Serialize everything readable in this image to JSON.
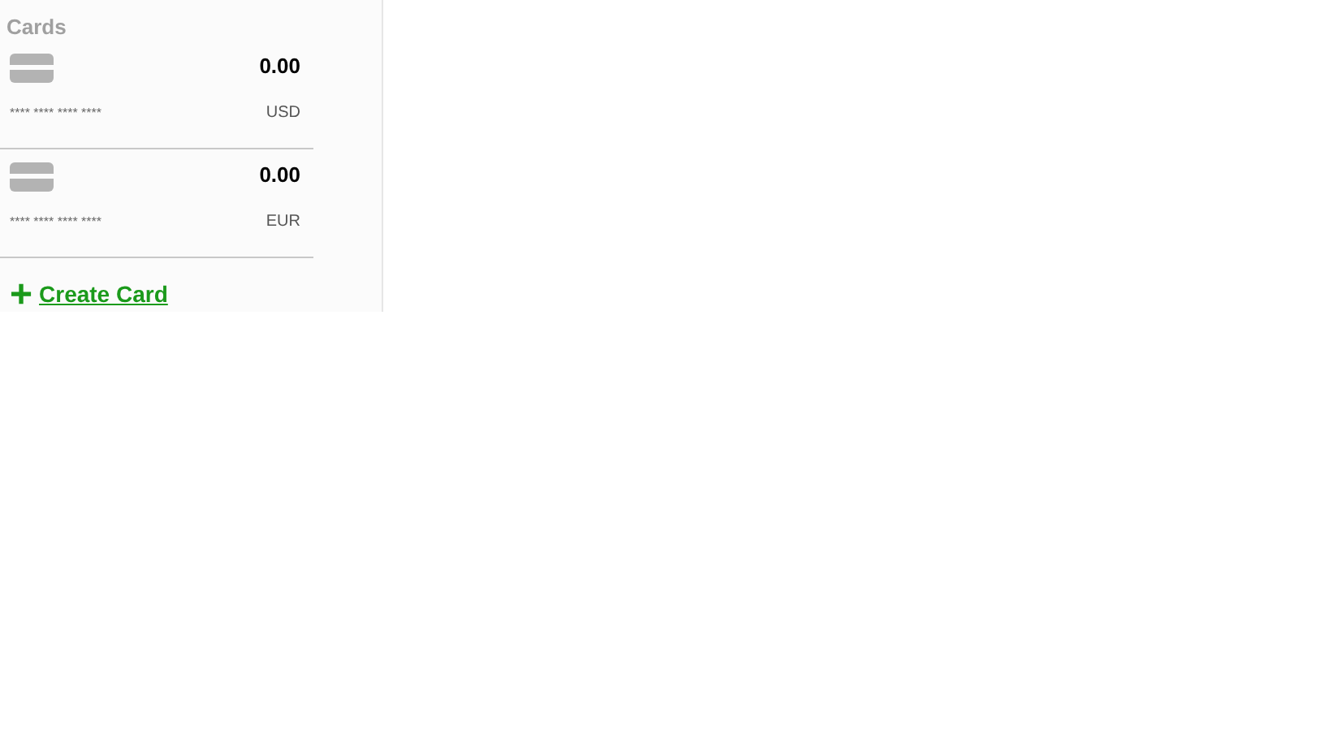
{
  "section_title": "Cards",
  "cards": [
    {
      "balance": "0.00",
      "number": "**** **** **** ****",
      "currency": "USD"
    },
    {
      "balance": "0.00",
      "number": "**** **** **** ****",
      "currency": "EUR"
    }
  ],
  "create_link": {
    "icon": "+",
    "label": "Create Card"
  }
}
